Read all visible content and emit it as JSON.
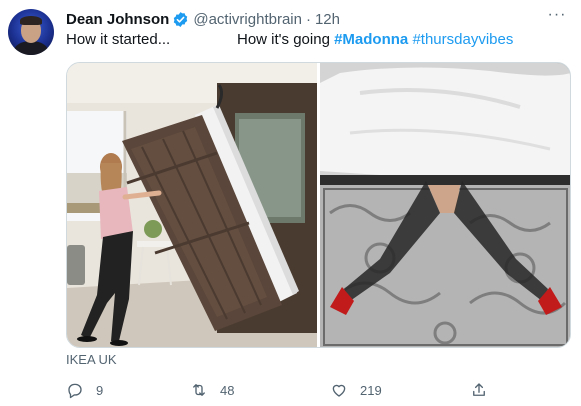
{
  "tweet": {
    "author_name": "Dean Johnson",
    "handle": "@activrightbrain",
    "separator": "·",
    "time": "12h",
    "more_label": "···",
    "text_part1": "How it started...",
    "text_part2": "How it's going",
    "hashtag_1": "#Madonna",
    "hashtag_2": "#thursdayvibes",
    "media_source": "IKEA UK"
  },
  "metrics": {
    "replies": "9",
    "retweets": "48",
    "likes": "219"
  },
  "colors": {
    "link": "#1d9bf0",
    "muted": "#536471",
    "verified": "#1d9bf0"
  },
  "icons": {
    "verified": "verified-badge-icon",
    "more": "more-icon",
    "reply": "reply-icon",
    "retweet": "retweet-icon",
    "like": "heart-icon",
    "share": "share-icon"
  }
}
